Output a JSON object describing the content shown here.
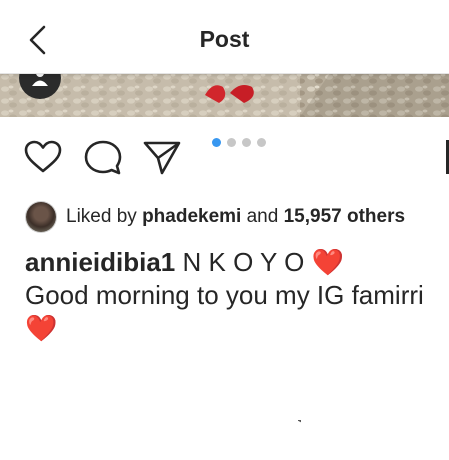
{
  "header": {
    "title": "Post",
    "back_icon": "chevron-left-icon"
  },
  "photo": {
    "avatar_icon": "user-icon"
  },
  "actions": {
    "like_icon": "heart-outline-icon",
    "comment_icon": "comment-bubble-icon",
    "share_icon": "paper-plane-icon",
    "carousel": {
      "total": 4,
      "active_index": 0,
      "active_color": "#3897f0"
    }
  },
  "likes": {
    "prefix": "Liked by",
    "user": "phadekemi",
    "joiner": "and",
    "count": "15,957 others"
  },
  "caption": {
    "username": "annieidibia1",
    "line1": "N K O Y O",
    "line2": "Good morning to you my IG famirri",
    "emoji": "❤️",
    "emoji_color": "#e0141e"
  }
}
